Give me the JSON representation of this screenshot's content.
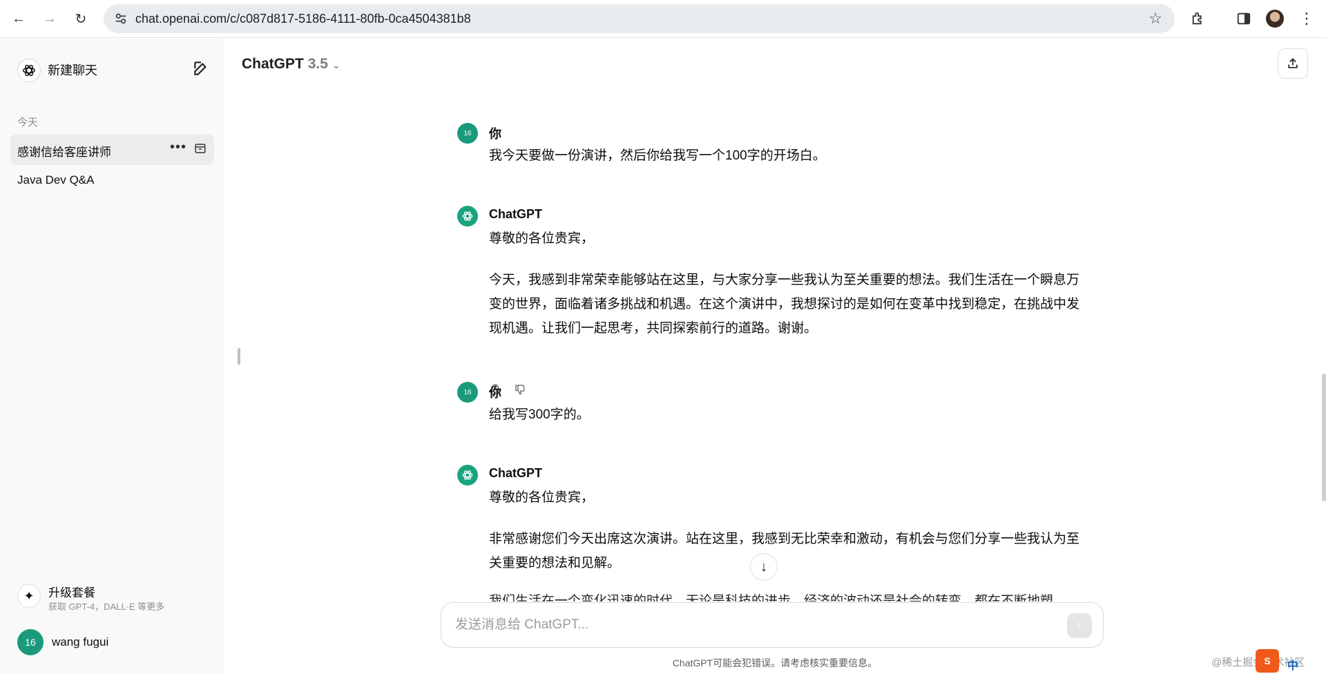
{
  "browser": {
    "url": "chat.openai.com/c/c087d817-5186-4111-80fb-0ca4504381b8"
  },
  "sidebar": {
    "new_chat": "新建聊天",
    "section_today": "今天",
    "conversations": [
      {
        "title": "感谢信给客座讲师",
        "active": true
      },
      {
        "title": "Java Dev Q&A",
        "active": false
      }
    ],
    "upgrade_title": "升级套餐",
    "upgrade_sub": "获取 GPT-4，DALL·E 等更多",
    "user_initials": "16",
    "user_name": "wang fugui"
  },
  "header": {
    "model_name": "ChatGPT",
    "model_version": "3.5"
  },
  "messages": [
    {
      "role": "user",
      "author": "你",
      "avatar": "16",
      "paragraphs": [
        "我今天要做一份演讲，然后你给我写一个100字的开场白。"
      ]
    },
    {
      "role": "assistant",
      "author": "ChatGPT",
      "paragraphs": [
        "尊敬的各位贵宾，",
        "今天，我感到非常荣幸能够站在这里，与大家分享一些我认为至关重要的想法。我们生活在一个瞬息万变的世界，面临着诸多挑战和机遇。在这个演讲中，我想探讨的是如何在变革中找到稳定，在挑战中发现机遇。让我们一起思考，共同探索前行的道路。谢谢。"
      ]
    },
    {
      "role": "user",
      "author": "你",
      "avatar": "16",
      "paragraphs": [
        "给我写300字的。"
      ]
    },
    {
      "role": "assistant",
      "author": "ChatGPT",
      "paragraphs": [
        "尊敬的各位贵宾，",
        "非常感谢您们今天出席这次演讲。站在这里，我感到无比荣幸和激动，有机会与您们分享一些我认为至关重要的想法和见解。"
      ]
    }
  ],
  "partial_line": "我们生活在一个变化迅速的时代，无论是科技的进步、经济的波动还是社会的转变，都在不断地塑",
  "composer": {
    "placeholder": "发送消息给 ChatGPT..."
  },
  "disclaimer": "ChatGPT可能会犯错误。请考虑核实重要信息。",
  "watermark": "@稀土掘金技术社区",
  "ime_indicator": "中"
}
